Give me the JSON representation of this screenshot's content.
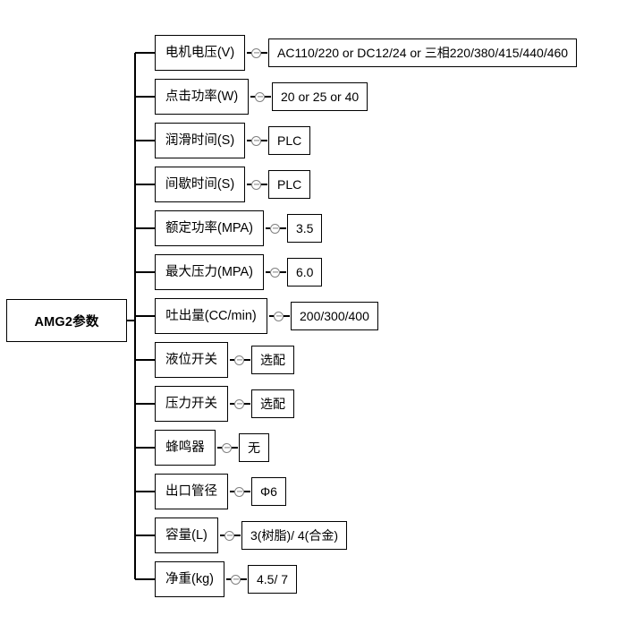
{
  "diagram": {
    "type": "tree",
    "title": "AMG2参数",
    "root": {
      "label": "AMG2参数"
    },
    "branches": [
      {
        "label": "电机电压(V)",
        "value": "AC110/220 or DC12/24 or 三相220/380/415/440/460"
      },
      {
        "label": "点击功率(W)",
        "value": "20 or 25 or 40"
      },
      {
        "label": "润滑时间(S)",
        "value": "PLC"
      },
      {
        "label": "间歇时间(S)",
        "value": "PLC"
      },
      {
        "label": "额定功率(MPA)",
        "value": "3.5"
      },
      {
        "label": "最大压力(MPA)",
        "value": "6.0"
      },
      {
        "label": "吐出量(CC/min)",
        "value": "200/300/400"
      },
      {
        "label": "液位开关",
        "value": "选配"
      },
      {
        "label": "压力开关",
        "value": "选配"
      },
      {
        "label": "蜂鸣器",
        "value": "无"
      },
      {
        "label": "出口管径",
        "value": "Φ6"
      },
      {
        "label": "容量(L)",
        "value": "3(树脂)/ 4(合金)"
      },
      {
        "label": "净重(kg)",
        "value": "4.5/ 7"
      }
    ],
    "colors": {
      "background": "#ffffff",
      "line": "#000000",
      "text": "#000000",
      "connector": "#808080"
    }
  }
}
